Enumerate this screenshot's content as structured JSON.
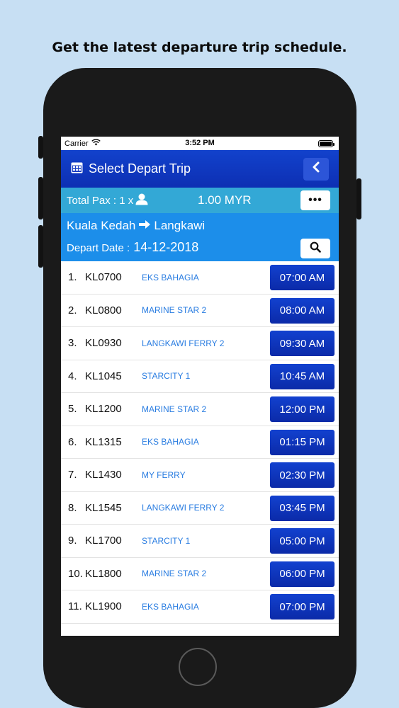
{
  "headline": "Get the latest departure trip schedule.",
  "status_bar": {
    "carrier": "Carrier",
    "time": "3:52 PM"
  },
  "nav": {
    "title": "Select Depart Trip",
    "calendar_icon": "calendar-icon",
    "back_icon": "chevron-left-icon"
  },
  "pax": {
    "label": "Total Pax : 1 x",
    "price": "1.00 MYR",
    "more_label": "•••"
  },
  "route": {
    "from": "Kuala Kedah",
    "to": "Langkawi",
    "date_label": "Depart Date :",
    "date_value": "14-12-2018"
  },
  "trips": [
    {
      "num": "1.",
      "code": "KL0700",
      "vessel": "EKS BAHAGIA",
      "time": "07:00 AM"
    },
    {
      "num": "2.",
      "code": "KL0800",
      "vessel": "MARINE STAR 2",
      "time": "08:00 AM"
    },
    {
      "num": "3.",
      "code": "KL0930",
      "vessel": "LANGKAWI FERRY 2",
      "time": "09:30 AM"
    },
    {
      "num": "4.",
      "code": "KL1045",
      "vessel": "STARCITY 1",
      "time": "10:45 AM"
    },
    {
      "num": "5.",
      "code": "KL1200",
      "vessel": "MARINE STAR 2",
      "time": "12:00 PM"
    },
    {
      "num": "6.",
      "code": "KL1315",
      "vessel": "EKS BAHAGIA",
      "time": "01:15 PM"
    },
    {
      "num": "7.",
      "code": "KL1430",
      "vessel": "MY FERRY",
      "time": "02:30 PM"
    },
    {
      "num": "8.",
      "code": "KL1545",
      "vessel": "LANGKAWI FERRY 2",
      "time": "03:45 PM"
    },
    {
      "num": "9.",
      "code": "KL1700",
      "vessel": "STARCITY 1",
      "time": "05:00 PM"
    },
    {
      "num": "10.",
      "code": "KL1800",
      "vessel": "MARINE STAR 2",
      "time": "06:00 PM"
    },
    {
      "num": "11.",
      "code": "KL1900",
      "vessel": "EKS BAHAGIA",
      "time": "07:00 PM"
    }
  ],
  "colors": {
    "nav_blue": "#0d2fb3",
    "pax_cyan": "#33a8d6",
    "route_blue": "#1c8eea",
    "vessel_text": "#2a7de1"
  }
}
